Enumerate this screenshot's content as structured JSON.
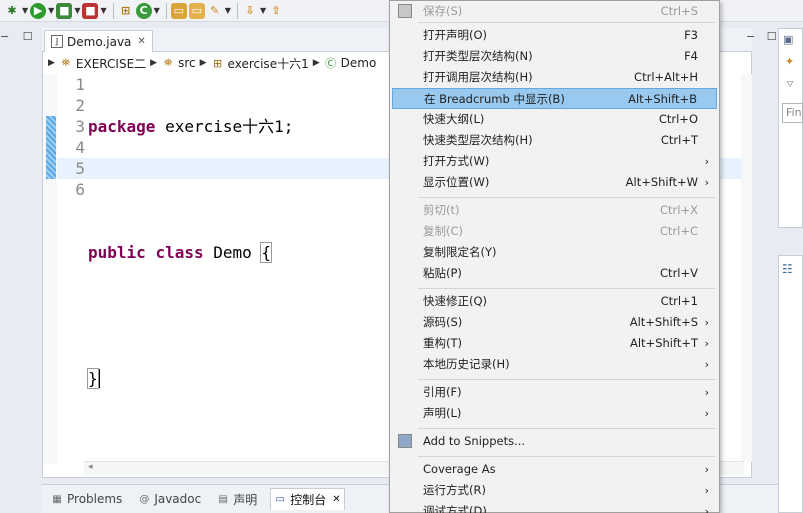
{
  "editor": {
    "tab_title": "Demo.java",
    "breadcrumb": [
      "EXERCISE二",
      "src",
      "exercise十六1",
      "Demo"
    ],
    "line_numbers": [
      "1",
      "2",
      "3",
      "4",
      "5",
      "6"
    ],
    "code": {
      "line1_kw": "package",
      "line1_rest": " exercise十六1;",
      "line3_kw1": "public",
      "line3_kw2": "class",
      "line3_rest": " Demo ",
      "line3_brace": "{",
      "line5_brace": "}"
    }
  },
  "right_panel": {
    "filter_placeholder": "Fin"
  },
  "bottom_tabs": [
    {
      "label": "Problems"
    },
    {
      "label": "Javadoc"
    },
    {
      "label": "声明"
    },
    {
      "label": "控制台"
    }
  ],
  "context_menu": {
    "items": [
      {
        "label": "保存(S)",
        "shortcut": "Ctrl+S",
        "disabled": true
      },
      {
        "label": "打开声明(O)",
        "shortcut": "F3"
      },
      {
        "label": "打开类型层次结构(N)",
        "shortcut": "F4"
      },
      {
        "label": "打开调用层次结构(H)",
        "shortcut": "Ctrl+Alt+H"
      },
      {
        "label": "在 Breadcrumb 中显示(B)",
        "shortcut": "Alt+Shift+B",
        "highlighted": true
      },
      {
        "label": "快速大纲(L)",
        "shortcut": "Ctrl+O"
      },
      {
        "label": "快速类型层次结构(H)",
        "shortcut": "Ctrl+T"
      },
      {
        "label": "打开方式(W)",
        "shortcut": "",
        "submenu": true
      },
      {
        "label": "显示位置(W)",
        "shortcut": "Alt+Shift+W",
        "submenu": true
      },
      {
        "label": "剪切(t)",
        "shortcut": "Ctrl+X",
        "disabled": true
      },
      {
        "label": "复制(C)",
        "shortcut": "Ctrl+C",
        "disabled": true
      },
      {
        "label": "复制限定名(Y)",
        "shortcut": ""
      },
      {
        "label": "粘贴(P)",
        "shortcut": "Ctrl+V"
      },
      {
        "label": "快速修正(Q)",
        "shortcut": "Ctrl+1"
      },
      {
        "label": "源码(S)",
        "shortcut": "Alt+Shift+S",
        "submenu": true
      },
      {
        "label": "重构(T)",
        "shortcut": "Alt+Shift+T",
        "submenu": true
      },
      {
        "label": "本地历史记录(H)",
        "shortcut": "",
        "submenu": true
      },
      {
        "label": "引用(F)",
        "shortcut": "",
        "submenu": true
      },
      {
        "label": "声明(L)",
        "shortcut": "",
        "submenu": true
      },
      {
        "label": "Add to Snippets...",
        "shortcut": ""
      },
      {
        "label": "Coverage As",
        "shortcut": "",
        "submenu": true
      },
      {
        "label": "运行方式(R)",
        "shortcut": "",
        "submenu": true
      },
      {
        "label": "调试方式(D)",
        "shortcut": "",
        "submenu": true
      }
    ],
    "submenu_glyph": "›"
  },
  "colors": {
    "keyword": "#7f0055",
    "menu_highlight": "#99c9ef",
    "current_line": "#e8f2fe"
  }
}
